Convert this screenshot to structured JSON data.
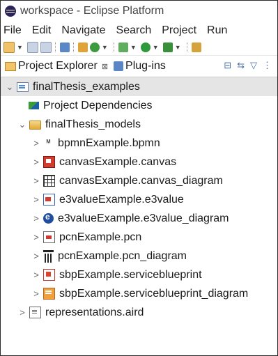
{
  "window": {
    "title": "workspace - Eclipse Platform"
  },
  "menu": {
    "items": [
      "File",
      "Edit",
      "Navigate",
      "Search",
      "Project",
      "Run"
    ]
  },
  "toolbar": {
    "icons": [
      "new-icon",
      "save-icon",
      "save-all-icon",
      "open-type-icon",
      "new-java-class-icon",
      "debug-icon",
      "run-icon",
      "external-tools-icon",
      "open-perspective-icon"
    ]
  },
  "tabs": {
    "project_explorer": {
      "label": "Project Explorer",
      "close": "⊠"
    },
    "plugins": {
      "label": "Plug-ins"
    }
  },
  "tree": {
    "project": {
      "name": "finalThesis_examples",
      "twisty": "⌄"
    },
    "deps": {
      "name": "Project Dependencies"
    },
    "models_folder": {
      "name": "finalThesis_models",
      "twisty": "⌄"
    },
    "files": [
      {
        "name": "bpmnExample.bpmn",
        "icon": "bpmn-file-icon",
        "twisty": ">"
      },
      {
        "name": "canvasExample.canvas",
        "icon": "canvas-file-icon",
        "twisty": ">"
      },
      {
        "name": "canvasExample.canvas_diagram",
        "icon": "canvas-diagram-icon",
        "twisty": ">"
      },
      {
        "name": "e3valueExample.e3value",
        "icon": "e3value-file-icon",
        "twisty": ">"
      },
      {
        "name": "e3valueExample.e3value_diagram",
        "icon": "e3value-diagram-icon",
        "twisty": ">"
      },
      {
        "name": "pcnExample.pcn",
        "icon": "pcn-file-icon",
        "twisty": ">"
      },
      {
        "name": "pcnExample.pcn_diagram",
        "icon": "pcn-diagram-icon",
        "twisty": ">"
      },
      {
        "name": "sbpExample.serviceblueprint",
        "icon": "sbp-file-icon",
        "twisty": ">"
      },
      {
        "name": "sbpExample.serviceblueprint_diagram",
        "icon": "sbp-diagram-icon",
        "twisty": ">"
      }
    ],
    "representations": {
      "name": "representations.aird",
      "twisty": ">"
    }
  },
  "colors": {
    "selection": "#e5e5e5",
    "border": "#2b2b2b"
  }
}
